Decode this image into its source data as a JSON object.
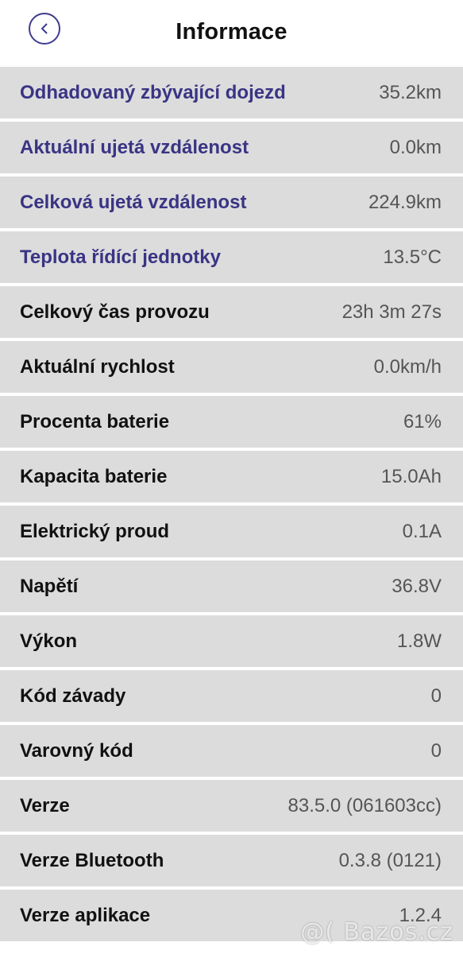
{
  "header": {
    "title": "Informace",
    "back_icon": "chevron-left-icon"
  },
  "colors": {
    "accent": "#3a3484",
    "row_background": "#dcdcdc"
  },
  "rows": [
    {
      "label": "Odhadovaný zbývající dojezd",
      "value": "35.2km"
    },
    {
      "label": "Aktuální ujetá vzdálenost",
      "value": "0.0km"
    },
    {
      "label": "Celková ujetá vzdálenost",
      "value": "224.9km"
    },
    {
      "label": "Teplota řídící jednotky",
      "value": "13.5°C"
    },
    {
      "label": "Celkový čas provozu",
      "value": "23h 3m 27s"
    },
    {
      "label": "Aktuální rychlost",
      "value": "0.0km/h"
    },
    {
      "label": "Procenta baterie",
      "value": "61%"
    },
    {
      "label": "Kapacita baterie",
      "value": "15.0Ah"
    },
    {
      "label": "Elektrický proud",
      "value": "0.1A"
    },
    {
      "label": "Napětí",
      "value": "36.8V"
    },
    {
      "label": "Výkon",
      "value": "1.8W"
    },
    {
      "label": "Kód závady",
      "value": "0"
    },
    {
      "label": "Varovný kód",
      "value": "0"
    },
    {
      "label": "Verze",
      "value": "83.5.0 (061603cc)"
    },
    {
      "label": "Verze Bluetooth",
      "value": "0.3.8 (0121)"
    },
    {
      "label": "Verze aplikace",
      "value": "1.2.4"
    }
  ],
  "watermark": "@( Bazos.cz"
}
